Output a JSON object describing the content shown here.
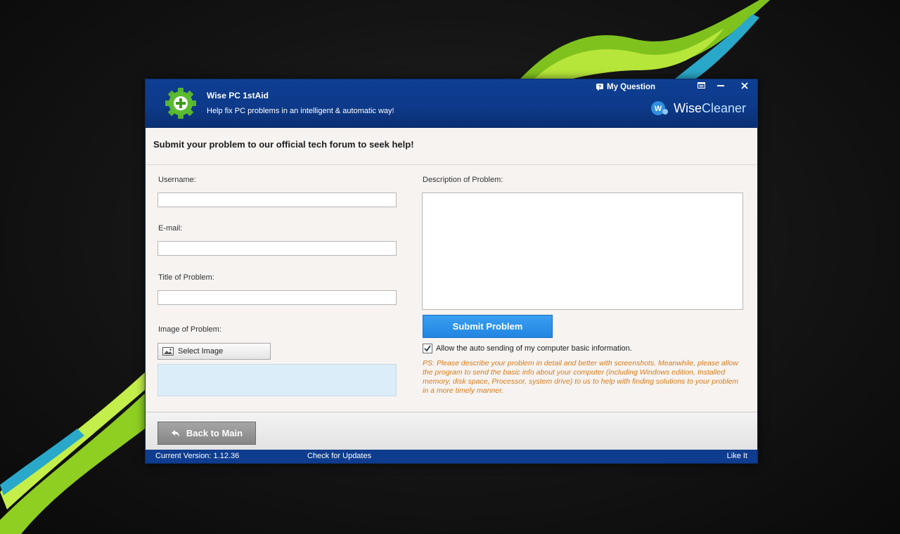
{
  "window": {
    "app_name": "Wise PC 1stAid",
    "tagline": "Help fix PC problems in an intelligent & automatic way!",
    "my_question": "My Question",
    "brand_prefix": "Wise",
    "brand_suffix": "Cleaner",
    "brand_logo_letter": "W"
  },
  "form": {
    "heading": "Submit your problem to our official tech forum to seek help!",
    "username_label": "Username:",
    "username_value": "",
    "email_label": "E-mail:",
    "email_value": "",
    "title_label": "Title of Problem:",
    "title_value": "",
    "image_label": "Image of Problem:",
    "select_image": "Select Image",
    "description_label": "Description of Problem:",
    "description_value": "",
    "submit": "Submit Problem",
    "auto_send_label": "Allow the auto sending of my computer basic information.",
    "auto_send_checked": true,
    "ps_note": "PS: Please describe your problem in detail and better with screenshots. Meanwhile, please allow the program to send the basic info about your computer (including Windows edition, Installed memory, disk space, Processor, system drive) to us to help with finding solutions to your problem in a more timely manner."
  },
  "footer": {
    "back": "Back to Main",
    "version": "Current Version: 1.12.36",
    "check_updates": "Check for Updates",
    "like": "Like It"
  },
  "icons": {
    "app_logo": "green-gear-plus-icon",
    "my_question": "question-bubble-icon",
    "menu": "menu-icon",
    "minimize": "minimize-icon",
    "close": "close-icon",
    "select_image": "image-icon",
    "back": "back-arrow-icon",
    "check": "checkmark-icon"
  },
  "colors": {
    "titlebar": "#0e3f93",
    "submit_button": "#2a8ee6",
    "ps_note": "#d97a16",
    "statusbar": "#0e3d8f",
    "wallpaper_swoosh": "#9fd62a"
  }
}
